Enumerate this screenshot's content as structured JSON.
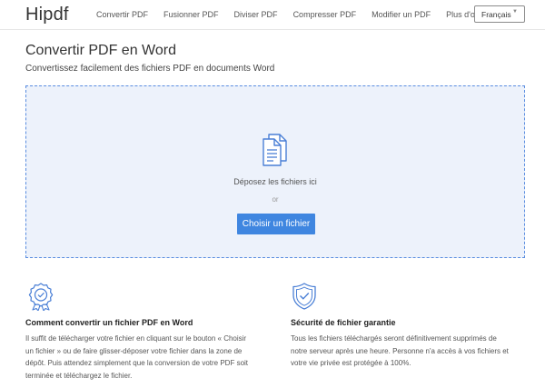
{
  "header": {
    "logo": "Hipdf",
    "nav": [
      "Convertir PDF",
      "Fusionner PDF",
      "Diviser PDF",
      "Compresser PDF",
      "Modifier un PDF",
      "Plus d'outils"
    ],
    "language": "Français"
  },
  "main": {
    "title": "Convertir PDF en Word",
    "subtitle": "Convertissez facilement des fichiers PDF en documents Word"
  },
  "dropzone": {
    "drop_text": "Déposez les fichiers ici",
    "or_text": "or",
    "button_label": "Choisir un fichier"
  },
  "features": [
    {
      "icon": "award-icon",
      "title": "Comment convertir un fichier PDF en Word",
      "lines": [
        "Il suffit de télécharger votre fichier en cliquant sur le bouton « Choisir",
        "un fichier » ou de faire glisser-déposer votre fichier dans la zone de",
        "dépôt. Puis attendez simplement que la conversion de votre PDF soit",
        "terminée et téléchargez le fichier."
      ]
    },
    {
      "icon": "shield-check-icon",
      "title": "Sécurité de fichier garantie",
      "lines": [
        "Tous les fichiers téléchargés seront définitivement supprimés de",
        "notre serveur après une heure. Personne n'a accès à vos fichiers et",
        "votre vie privée est protégée à 100%."
      ]
    }
  ],
  "colors": {
    "accent": "#3f86e0",
    "dropzone_bg": "#edf2fb",
    "dropzone_border": "#5a8de0",
    "icon_blue": "#4a7fd6"
  }
}
